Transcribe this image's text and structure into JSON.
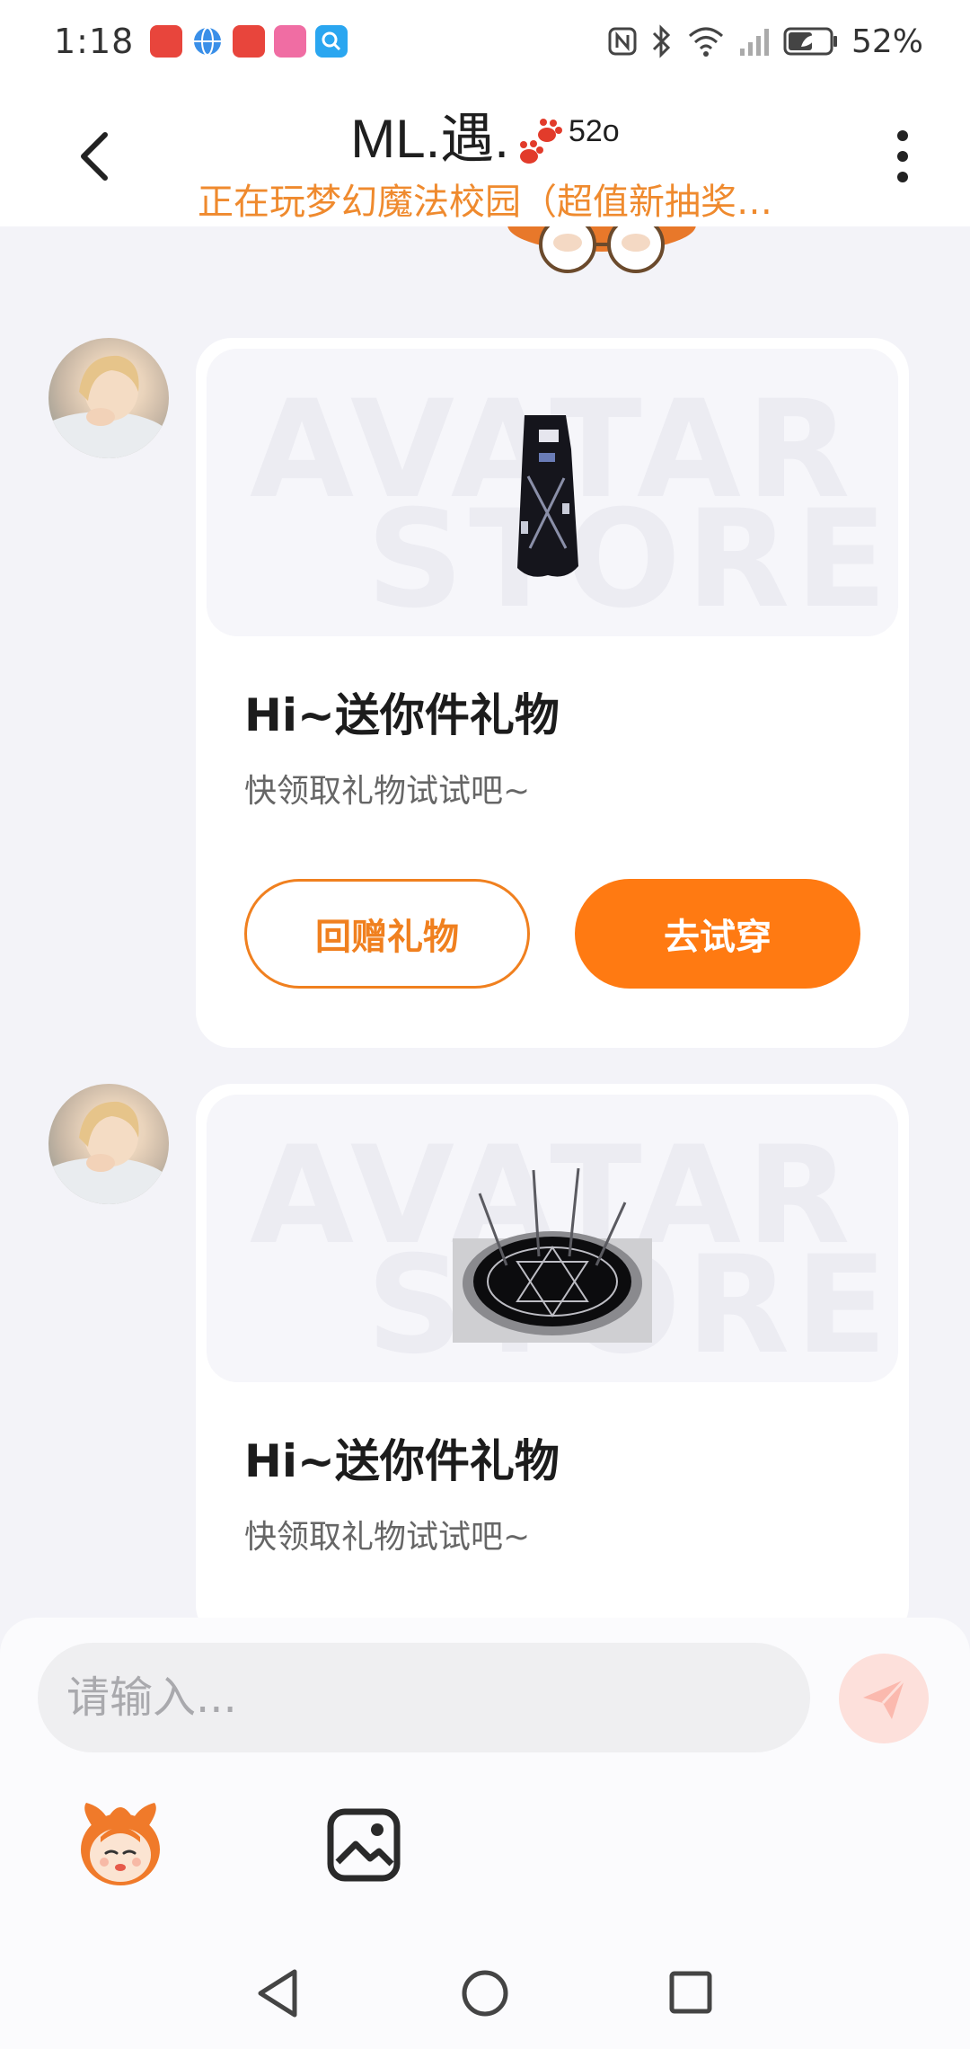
{
  "status_bar": {
    "time": "1:18",
    "battery": "52%",
    "notification_apps": [
      {
        "name": "huawei-appgallery",
        "color": "#e8453c",
        "label": "HUAWEI"
      },
      {
        "name": "browser",
        "color": "#3a8fe8",
        "label": ""
      },
      {
        "name": "huawei-store",
        "color": "#e8453c",
        "label": "HUAWEI"
      },
      {
        "name": "bilibili",
        "color": "#f06da3",
        "label": "bilibili"
      },
      {
        "name": "search",
        "color": "#2aa6f0",
        "label": ""
      }
    ]
  },
  "header": {
    "title_main": "ML.遇.",
    "title_suffix": "52o",
    "subtitle": "正在玩梦幻魔法校园（超值新抽奖…",
    "back_icon": "chevron-left-icon",
    "more_icon": "more-vertical-icon"
  },
  "messages": [
    {
      "title": "Hi~送你件礼物",
      "description": "快领取礼物试试吧~",
      "watermark_line1": "AVATAR",
      "watermark_line2": "STORE",
      "gift": "black-outfit",
      "return_gift_label": "回赠礼物",
      "try_on_label": "去试穿"
    },
    {
      "title": "Hi~送你件礼物",
      "description": "快领取礼物试试吧~",
      "watermark_line1": "AVATAR",
      "watermark_line2": "STORE",
      "gift": "magic-circle"
    }
  ],
  "input": {
    "placeholder": "请输入..."
  },
  "colors": {
    "accent": "#ff7a12",
    "subtitle": "#ef8a2e",
    "background": "#f3f3f8"
  }
}
